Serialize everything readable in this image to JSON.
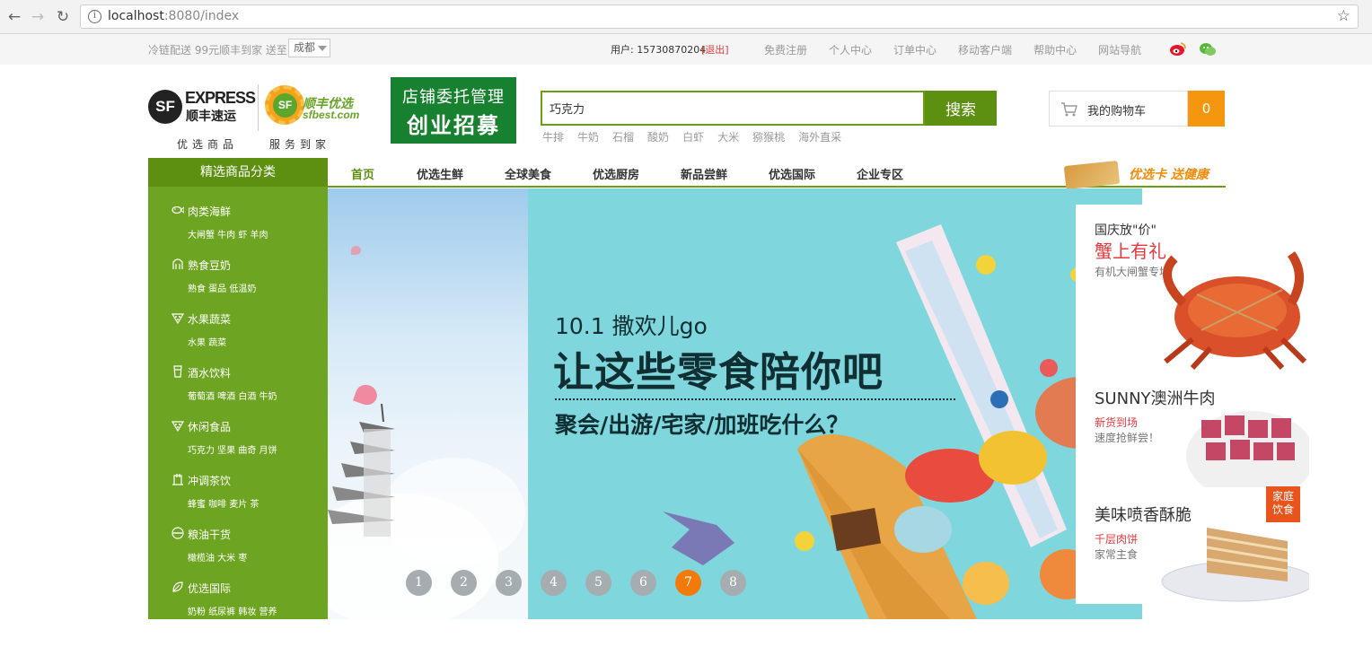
{
  "browser": {
    "url_host": "localhost",
    "url_rest": ":8080/index"
  },
  "topbar": {
    "delivery_text": "冷链配送 99元顺丰到家 送至:",
    "city": "成都",
    "user_label": "用户: 15730870204",
    "logout": "[退出]",
    "links": [
      "免费注册",
      "个人中心",
      "订单中心",
      "移动客户端",
      "帮助中心",
      "网站导航"
    ]
  },
  "header": {
    "sf_logo_letters": "SF",
    "sf_express": "EXPRESS",
    "sf_cn": "顺丰速运",
    "best_logo_letters": "SF",
    "best_cn": "顺丰优选",
    "best_domain": "sfbest.com",
    "slogan_left": "优选商品",
    "slogan_right": "服务到家",
    "promo_line1": "店铺委托管理",
    "promo_line2": "创业招募",
    "search_value": "巧克力",
    "search_button": "搜索",
    "hot_keywords": [
      "牛排",
      "牛奶",
      "石榴",
      "酸奶",
      "白虾",
      "大米",
      "猕猴桃",
      "海外直采"
    ],
    "cart_label": "我的购物车",
    "cart_count": "0"
  },
  "nav": {
    "category_title": "精选商品分类",
    "items": [
      "首页",
      "优选生鲜",
      "全球美食",
      "优选厨房",
      "新品尝鲜",
      "优选国际",
      "企业专区"
    ],
    "card_promo": "优选卡 送健康"
  },
  "sidebar": {
    "categories": [
      {
        "title": "肉类海鲜",
        "sub": "大闸蟹 牛肉 虾 羊肉",
        "icon": "fish-icon"
      },
      {
        "title": "熟食豆奶",
        "sub": "熟食 蛋品 低温奶",
        "icon": "arch-icon"
      },
      {
        "title": "水果蔬菜",
        "sub": "水果 蔬菜",
        "icon": "grape-icon"
      },
      {
        "title": "酒水饮料",
        "sub": "葡萄酒 啤酒 白酒 牛奶",
        "icon": "cup-icon"
      },
      {
        "title": "休闲食品",
        "sub": "巧克力 坚果 曲奇 月饼",
        "icon": "grape-icon"
      },
      {
        "title": "冲调茶饮",
        "sub": "蜂蜜 咖啡 麦片 茶",
        "icon": "kettle-icon"
      },
      {
        "title": "粮油干货",
        "sub": "橄榄油 大米 枣",
        "icon": "bowl-icon"
      },
      {
        "title": "优选国际",
        "sub": "奶粉 纸尿裤 韩妆 营养",
        "icon": "leaf-icon"
      }
    ]
  },
  "banner": {
    "line1": "10.1 撒欢儿go",
    "line2": "让这些零食陪你吧",
    "line3": "聚会/出游/宅家/加班吃什么？",
    "pages": [
      "1",
      "2",
      "3",
      "4",
      "5",
      "6",
      "7",
      "8"
    ],
    "active_page": "7"
  },
  "right_promos": {
    "p1_head": "国庆放\"价\"",
    "p1_big": "蟹上有礼",
    "p1_sub": "有机大闸蟹专场",
    "p2_title": "SUNNY澳洲牛肉",
    "p2_red": "新货到场",
    "p2_sub": "速度抢鲜尝！",
    "p3_title": "美味喷香酥脆",
    "p3_red": "千层肉饼",
    "p3_sub": "家常主食",
    "p3_tag_line1": "家庭",
    "p3_tag_line2": "饮食"
  },
  "colors": {
    "brand_green": "#5d8f10",
    "sidebar_green": "#6da421",
    "accent_orange": "#f4970e",
    "logout_red": "#e4393c"
  }
}
